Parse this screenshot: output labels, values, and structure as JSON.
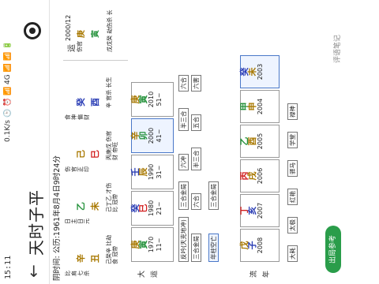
{
  "status": {
    "time": "15:11",
    "network": "0.1K/s 🕒 ⏰ 📶 4G 📶 📶 🔋"
  },
  "title": "天时子平",
  "info_line": "公历:1961年8月4日9时24分",
  "info_label": "阴时间:",
  "yun_header": "运",
  "yun_year": "2000/12",
  "pillars": [
    {
      "tg_top": "比肩 七杀",
      "gan": "辛",
      "zhi": "丑",
      "r": "己癸辛 比劫食 冠带",
      "gc": "brown",
      "zc": "brown"
    },
    {
      "tg_top": "日主 日元",
      "gan": "乙",
      "zhi": "未",
      "r": "己丁乙 才伤比 冠带",
      "gc": "green",
      "zc": "brown"
    },
    {
      "tg_top": "伤官 正印",
      "gan": "己",
      "zhi": "巳",
      "r": "丙庚戊 伤官财 帝旺",
      "gc": "brown",
      "zc": "red"
    },
    {
      "tg_top": "食神 偏财",
      "gan": "癸",
      "zhi": "酉",
      "r": "辛 官杀 长生",
      "gc": "navy",
      "zc": "blue"
    }
  ],
  "yun_pillar": {
    "a": "伤官",
    "gan": "庚",
    "zhi": "寅",
    "r": "戊戊癸 劫伤杀 长"
  },
  "big_luck": [
    {
      "g": "庚",
      "z": "寅",
      "y": "1970",
      "a": "11~"
    },
    {
      "g": "癸",
      "z": "巳",
      "y": "1980",
      "a": "21~"
    },
    {
      "g": "壬",
      "z": "辰",
      "y": "1990",
      "a": "31~"
    },
    {
      "g": "辛",
      "z": "卯",
      "y": "2000",
      "a": "41~"
    },
    {
      "g": "庚",
      "z": "寅",
      "y": "2010",
      "a": "51~"
    }
  ],
  "years": [
    {
      "g": "戊",
      "z": "子",
      "y": "2008"
    },
    {
      "g": "丁",
      "z": "亥",
      "y": "2007"
    },
    {
      "g": "丙",
      "z": "戌",
      "y": "2006"
    },
    {
      "g": "乙",
      "z": "酉",
      "y": "2005"
    },
    {
      "g": "甲",
      "z": "申",
      "y": "2004"
    },
    {
      "g": "癸",
      "z": "未",
      "y": "2003"
    }
  ],
  "shensha": [
    "反吟(天克地冲)",
    "三合金局",
    "三合金局",
    "六合",
    "六冲",
    "半三合",
    "半三合",
    "五合",
    "六合",
    "六害",
    "年柱空亡",
    "三合金局",
    "大耗",
    "太极",
    "红艳",
    "驿马",
    "学堂",
    "禄神"
  ],
  "fab": "出局参考",
  "note": "评语笔记"
}
